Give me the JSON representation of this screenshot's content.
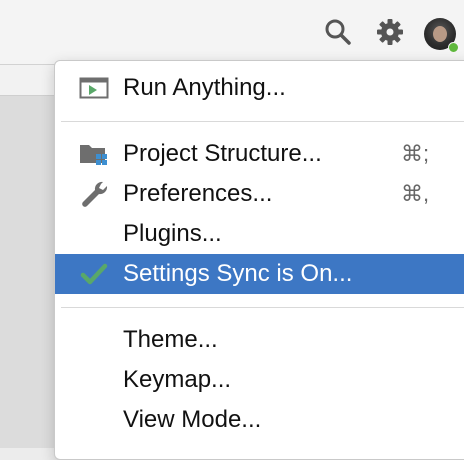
{
  "toolbar": {
    "icons": [
      "search-icon",
      "gear-icon",
      "user-avatar"
    ],
    "avatar_status_color": "#5fb83c"
  },
  "menu": {
    "items": [
      {
        "label": "Run Anything...",
        "icon": "run-anything-icon",
        "shortcut": ""
      },
      {
        "label": "Project Structure...",
        "icon": "project-structure-icon",
        "shortcut": "⌘;"
      },
      {
        "label": "Preferences...",
        "icon": "wrench-icon",
        "shortcut": "⌘,"
      },
      {
        "label": "Plugins...",
        "icon": "",
        "shortcut": ""
      },
      {
        "label": "Settings Sync is On...",
        "icon": "checkmark-icon",
        "shortcut": "",
        "selected": true
      },
      {
        "label": "Theme...",
        "icon": "",
        "shortcut": ""
      },
      {
        "label": "Keymap...",
        "icon": "",
        "shortcut": ""
      },
      {
        "label": "View Mode...",
        "icon": "",
        "shortcut": ""
      }
    ]
  },
  "colors": {
    "selection": "#3d77c4",
    "checkmark": "#59a869",
    "text": "#111111",
    "shortcut": "#666666"
  }
}
